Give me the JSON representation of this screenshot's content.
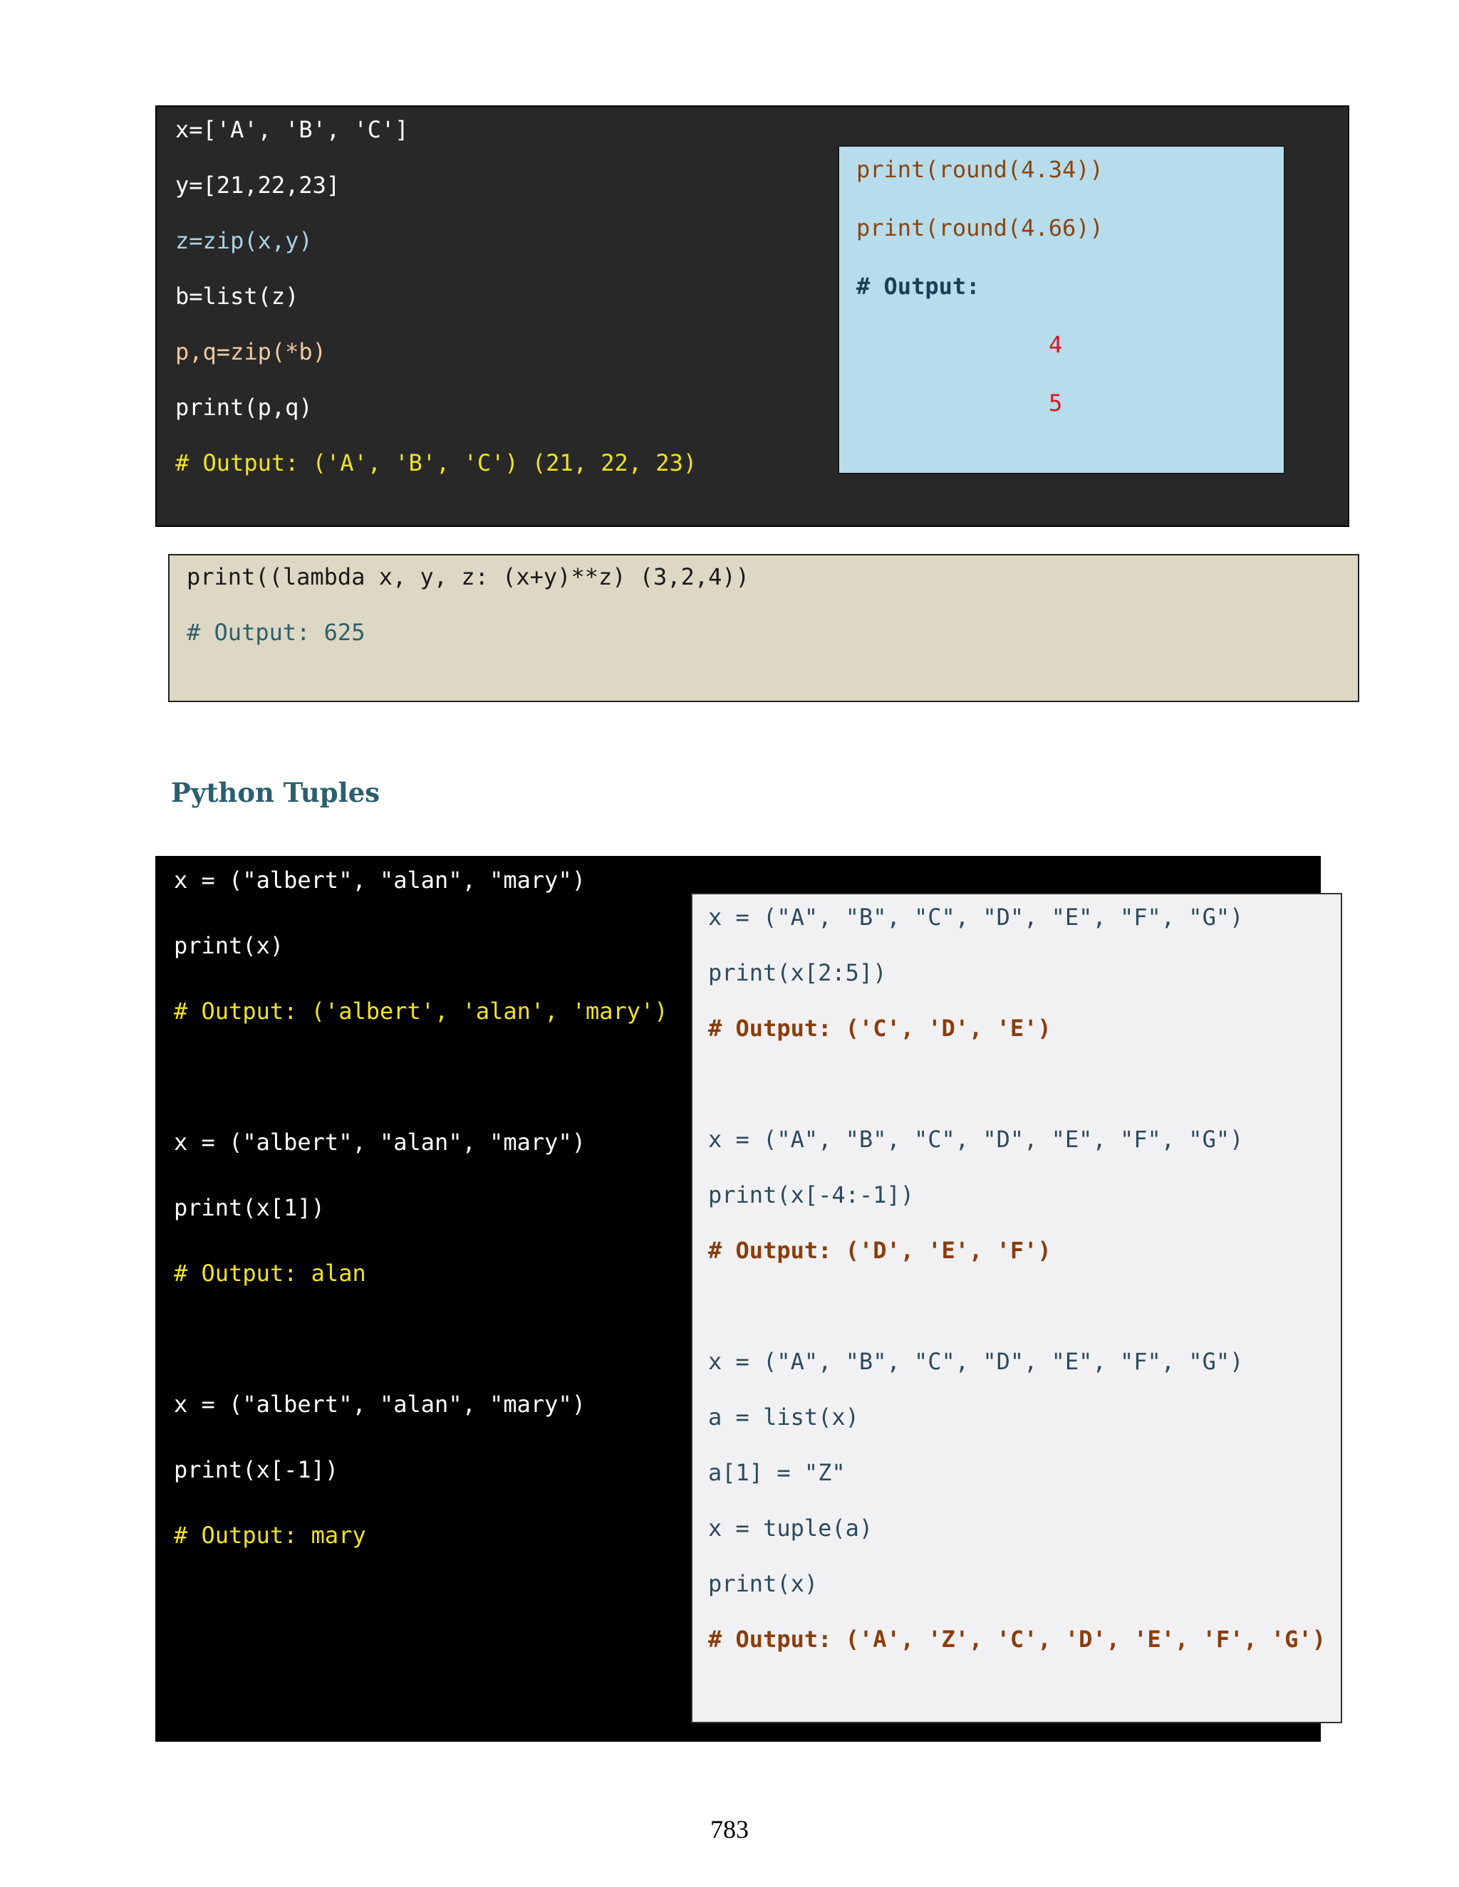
{
  "colors": {
    "white": "#ffffff",
    "light_blue_text": "#a9d1e6",
    "peach": "#f3c79e",
    "yellow": "#f0e321",
    "brown": "#8a4512",
    "navy": "#1b3f55",
    "red": "#e0101c",
    "dark": "#1a1a1a",
    "teal": "#2e5f6a",
    "slate": "#2d4a5c",
    "comment_brown": "#8a3d0a"
  },
  "box_a": {
    "lines": [
      "x=['A', 'B', 'C']",
      "y=[21,22,23]",
      "z=zip(x,y)",
      "b=list(z)",
      "p,q=zip(*b)",
      "print(p,q)",
      "# Output: ('A', 'B', 'C') (21, 22, 23)"
    ]
  },
  "box_b": {
    "lines": [
      "print(round(4.34))",
      "print(round(4.66))",
      "# Output:",
      "4",
      "5"
    ]
  },
  "box_c": {
    "lines": [
      "print((lambda x, y, z: (x+y)**z) (3,2,4))",
      "# Output: 625"
    ]
  },
  "section_title": "Python Tuples",
  "box_d": {
    "lines": [
      "x = (\"albert\", \"alan\", \"mary\")",
      "print(x)",
      "# Output: ('albert', 'alan', 'mary')",
      "x = (\"albert\", \"alan\", \"mary\")",
      "print(x[1])",
      "# Output: alan",
      "x = (\"albert\", \"alan\", \"mary\")",
      "print(x[-1])",
      "# Output: mary"
    ]
  },
  "box_e": {
    "lines": [
      "x = (\"A\", \"B\", \"C\", \"D\", \"E\", \"F\", \"G\")",
      "print(x[2:5])",
      "# Output: ('C', 'D', 'E')",
      "x = (\"A\", \"B\", \"C\", \"D\", \"E\", \"F\", \"G\")",
      "print(x[-4:-1])",
      "# Output: ('D', 'E', 'F')",
      "x = (\"A\", \"B\", \"C\", \"D\", \"E\", \"F\", \"G\")",
      "a = list(x)",
      "a[1] = \"Z\"",
      "x = tuple(a)",
      "print(x)",
      "# Output: ('A', 'Z', 'C', 'D', 'E', 'F', 'G')"
    ]
  },
  "page_number": "783"
}
